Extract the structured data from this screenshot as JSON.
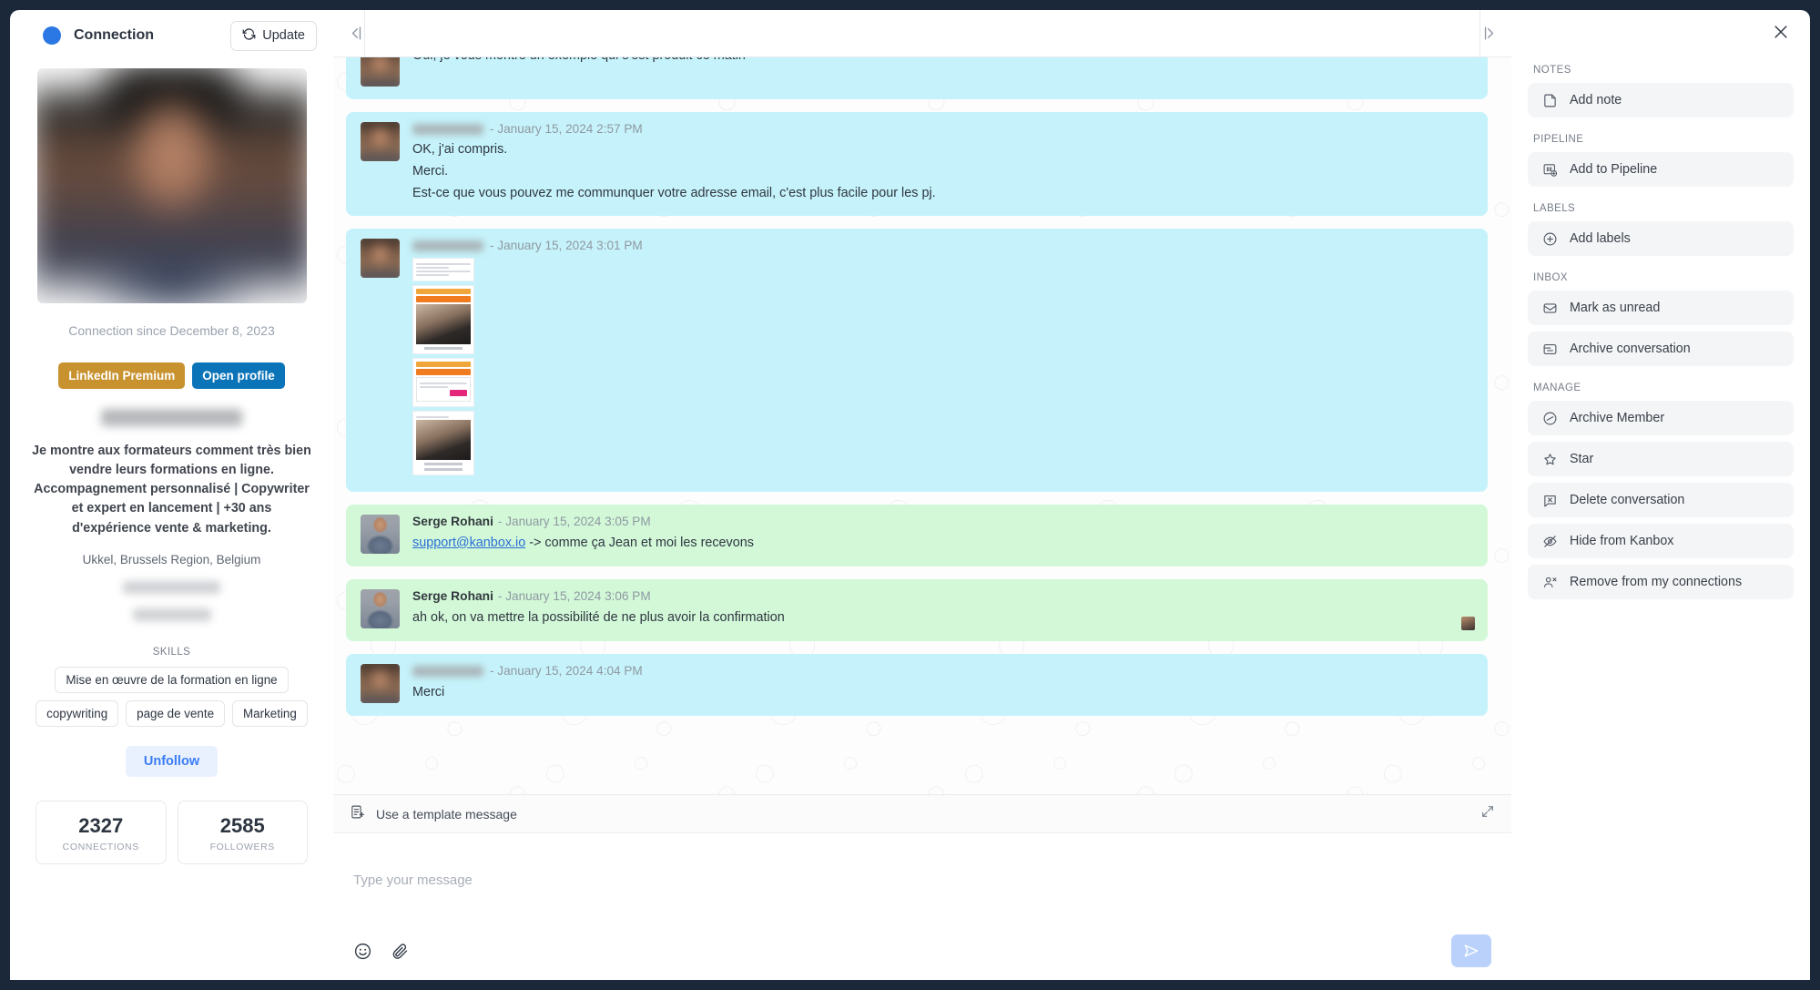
{
  "profile": {
    "status_label": "Connection",
    "update_label": "Update",
    "connection_since": "Connection since December 8, 2023",
    "premium_badge": "LinkedIn Premium",
    "open_profile": "Open profile",
    "name": "",
    "headline": "Je montre aux formateurs comment très bien vendre leurs formations en ligne. Accompagnement personnalisé | Copywriter et expert en lancement | +30 ans d'expérience vente & marketing.",
    "location": "Ukkel, Brussels Region, Belgium",
    "skills_title": "SKILLS",
    "skills": [
      "Mise en œuvre de la formation en ligne",
      "copywriting",
      "page de vente",
      "Marketing"
    ],
    "unfollow_label": "Unfollow",
    "stats": [
      {
        "value": "2327",
        "label": "CONNECTIONS"
      },
      {
        "value": "2585",
        "label": "FOLLOWERS"
      }
    ],
    "accent_blue": "#2b78e4",
    "premium_color": "#c8922f",
    "open_profile_color": "#0b74b8"
  },
  "chat": {
    "messages": [
      {
        "id": "m1",
        "side": "them",
        "sender": "",
        "sender_redacted": true,
        "time": "",
        "show_meta": false,
        "lines": [
          "Oui, je vous montre un exemple qui s'est produit ce matin"
        ],
        "has_attachment": false,
        "seen": false
      },
      {
        "id": "m2",
        "side": "them",
        "sender": "",
        "sender_redacted": true,
        "time": "- January 15, 2024 2:57 PM",
        "show_meta": true,
        "lines": [
          "OK, j'ai compris.",
          "Merci.",
          "Est-ce que vous pouvez me communquer votre adresse email, c'est plus facile pour les pj."
        ],
        "has_attachment": false,
        "seen": false
      },
      {
        "id": "m3",
        "side": "them",
        "sender": "",
        "sender_redacted": true,
        "time": "- January 15, 2024 3:01 PM",
        "show_meta": true,
        "lines": [],
        "has_attachment": true,
        "seen": false
      },
      {
        "id": "m4",
        "side": "me",
        "sender": "Serge Rohani",
        "sender_redacted": false,
        "time": "- January 15, 2024 3:05 PM",
        "show_meta": true,
        "lines": [],
        "link_text": "support@kanbox.io",
        "after_link": " -> comme ça Jean et moi les recevons",
        "has_attachment": false,
        "seen": false
      },
      {
        "id": "m5",
        "side": "me",
        "sender": "Serge Rohani",
        "sender_redacted": false,
        "time": "- January 15, 2024 3:06 PM",
        "show_meta": true,
        "lines": [
          "ah ok, on va mettre la possibilité de ne plus avoir la confirmation"
        ],
        "has_attachment": false,
        "seen": true
      },
      {
        "id": "m6",
        "side": "them",
        "sender": "",
        "sender_redacted": true,
        "time": "- January 15, 2024 4:04 PM",
        "show_meta": true,
        "lines": [
          "Merci"
        ],
        "has_attachment": false,
        "seen": false
      }
    ],
    "bubble_them_color": "#c6f3fb",
    "bubble_me_color": "#d2f8d8"
  },
  "composer": {
    "template_label": "Use a template message",
    "input_placeholder": "Type your message",
    "input_value": ""
  },
  "actions": {
    "sections": [
      {
        "title": "NOTES",
        "items": [
          {
            "label": "Add note",
            "icon": "note-icon"
          }
        ]
      },
      {
        "title": "PIPELINE",
        "items": [
          {
            "label": "Add to Pipeline",
            "icon": "pipeline-icon"
          }
        ]
      },
      {
        "title": "LABELS",
        "items": [
          {
            "label": "Add labels",
            "icon": "plus-circle-icon"
          }
        ]
      },
      {
        "title": "INBOX",
        "items": [
          {
            "label": "Mark as unread",
            "icon": "envelope-icon"
          },
          {
            "label": "Archive conversation",
            "icon": "archive-icon"
          }
        ]
      },
      {
        "title": "MANAGE",
        "items": [
          {
            "label": "Archive Member",
            "icon": "minus-circle-icon"
          },
          {
            "label": "Star",
            "icon": "star-icon"
          },
          {
            "label": "Delete conversation",
            "icon": "delete-chat-icon"
          },
          {
            "label": "Hide from Kanbox",
            "icon": "eye-off-icon"
          },
          {
            "label": "Remove from my connections",
            "icon": "user-remove-icon"
          }
        ]
      }
    ]
  }
}
